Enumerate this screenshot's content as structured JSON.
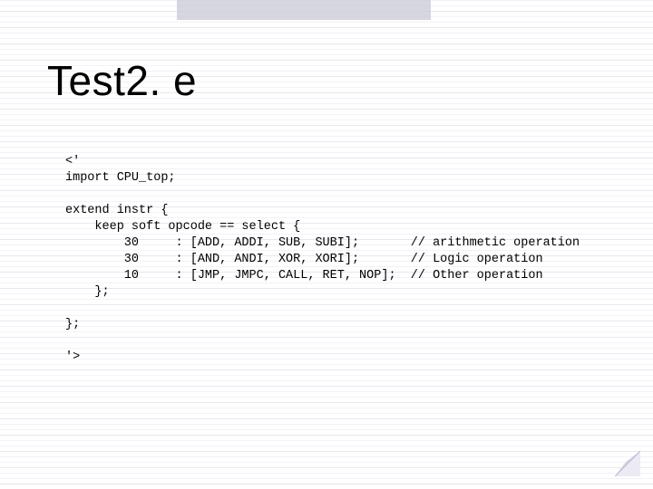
{
  "title": "Test2. e",
  "code": "<'\nimport CPU_top;\n\nextend instr {\n    keep soft opcode == select {\n        30     : [ADD, ADDI, SUB, SUBI];       // arithmetic operation\n        30     : [AND, ANDI, XOR, XORI];       // Logic operation\n        10     : [JMP, JMPC, CALL, RET, NOP];  // Other operation\n    };\n\n};\n\n'>"
}
